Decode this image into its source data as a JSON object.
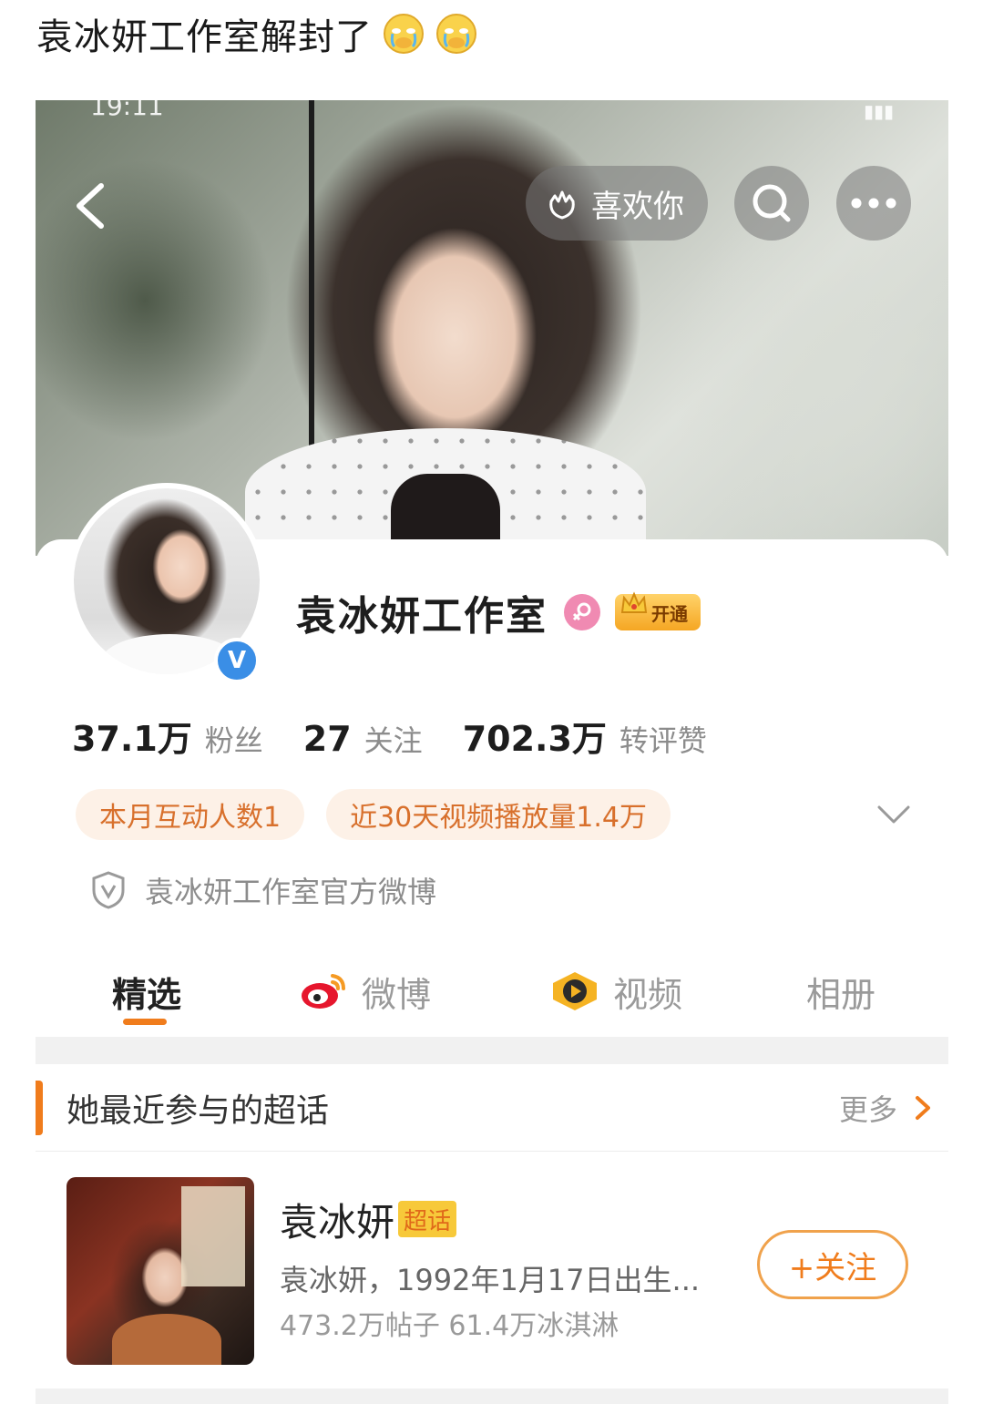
{
  "post": {
    "title": "袁冰妍工作室解封了",
    "emoji_icon": "crying-face-emoji"
  },
  "status_bar": {
    "time": "19:11"
  },
  "header": {
    "like_label": "喜欢你"
  },
  "profile": {
    "name": "袁冰妍工作室",
    "vip_label": "开通",
    "verified_badge": "V",
    "stats": [
      {
        "value": "37.1万",
        "label": "粉丝"
      },
      {
        "value": "27",
        "label": "关注"
      },
      {
        "value": "702.3万",
        "label": "转评赞"
      }
    ],
    "tags": [
      "本月互动人数1",
      "近30天视频播放量1.4万"
    ],
    "description": "袁冰妍工作室官方微博"
  },
  "tabs": [
    {
      "label": "精选",
      "active": true
    },
    {
      "label": "微博",
      "icon": "weibo-icon"
    },
    {
      "label": "视频",
      "icon": "video-icon"
    },
    {
      "label": "相册"
    }
  ],
  "super_topics": {
    "title": "她最近参与的超话",
    "more_label": "更多",
    "items": [
      {
        "name": "袁冰妍",
        "badge": "超话",
        "description": "袁冰妍，1992年1月17日出生...",
        "meta": "473.2万帖子 61.4万冰淇淋",
        "follow_label": "+关注"
      }
    ]
  },
  "colors": {
    "accent": "#f07c1c",
    "tag_bg": "#fdf1e7",
    "verified": "#3a8ee6",
    "vip_gold": "#f5a623"
  }
}
